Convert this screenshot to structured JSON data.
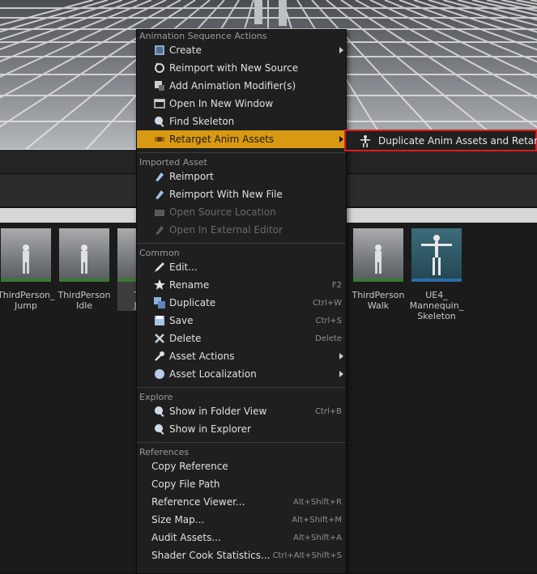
{
  "context_menu": {
    "sections": [
      {
        "header": "Animation Sequence Actions",
        "items": [
          {
            "label": "Create",
            "icon": "create-icon",
            "submenu": true
          },
          {
            "label": "Reimport with New Source",
            "icon": "reimport-source-icon"
          },
          {
            "label": "Add Animation Modifier(s)",
            "icon": "modifier-icon"
          },
          {
            "label": "Open In New Window",
            "icon": "open-window-icon"
          },
          {
            "label": "Find Skeleton",
            "icon": "find-icon"
          },
          {
            "label": "Retarget Anim Assets",
            "icon": "retarget-icon",
            "submenu": true,
            "highlighted": true
          }
        ]
      },
      {
        "header": "Imported Asset",
        "items": [
          {
            "label": "Reimport",
            "icon": "reimport-icon"
          },
          {
            "label": "Reimport With New File",
            "icon": "reimport-file-icon"
          },
          {
            "label": "Open Source Location",
            "icon": "folder-icon",
            "disabled": true
          },
          {
            "label": "Open In External Editor",
            "icon": "external-editor-icon",
            "disabled": true
          }
        ]
      },
      {
        "header": "Common",
        "items": [
          {
            "label": "Edit...",
            "icon": "edit-icon"
          },
          {
            "label": "Rename",
            "icon": "rename-icon",
            "shortcut": "F2"
          },
          {
            "label": "Duplicate",
            "icon": "duplicate-icon",
            "shortcut": "Ctrl+W"
          },
          {
            "label": "Save",
            "icon": "save-icon",
            "shortcut": "Ctrl+S"
          },
          {
            "label": "Delete",
            "icon": "delete-icon",
            "shortcut": "Delete"
          },
          {
            "label": "Asset Actions",
            "icon": "wrench-icon",
            "submenu": true
          },
          {
            "label": "Asset Localization",
            "icon": "globe-icon",
            "submenu": true
          }
        ]
      },
      {
        "header": "Explore",
        "items": [
          {
            "label": "Show in Folder View",
            "icon": "folder-view-icon",
            "shortcut": "Ctrl+B"
          },
          {
            "label": "Show in Explorer",
            "icon": "explorer-icon"
          }
        ]
      },
      {
        "header": "References",
        "items": [
          {
            "label": "Copy Reference"
          },
          {
            "label": "Copy File Path"
          },
          {
            "label": "Reference Viewer...",
            "shortcut": "Alt+Shift+R"
          },
          {
            "label": "Size Map...",
            "shortcut": "Alt+Shift+M"
          },
          {
            "label": "Audit Assets...",
            "shortcut": "Alt+Shift+A"
          },
          {
            "label": "Shader Cook Statistics...",
            "shortcut": "Ctrl+Alt+Shift+S"
          }
        ]
      }
    ]
  },
  "submenu": {
    "label": "Duplicate Anim Assets and Retarget",
    "icon": "retarget-figure-icon"
  },
  "assets": [
    {
      "label": "ThirdPerson_\nJump",
      "kind": "anim"
    },
    {
      "label": "ThirdPerson\nIdle",
      "kind": "anim"
    },
    {
      "label": "Thir\nJum",
      "kind": "anim",
      "selected": true
    },
    {
      "label": "ThirdPerson\nWalk",
      "kind": "anim"
    },
    {
      "label": "UE4_\nMannequin_\nSkeleton",
      "kind": "skeleton"
    }
  ],
  "colors": {
    "highlight": "#d89a12",
    "submenu_outline": "#e21b1b"
  }
}
